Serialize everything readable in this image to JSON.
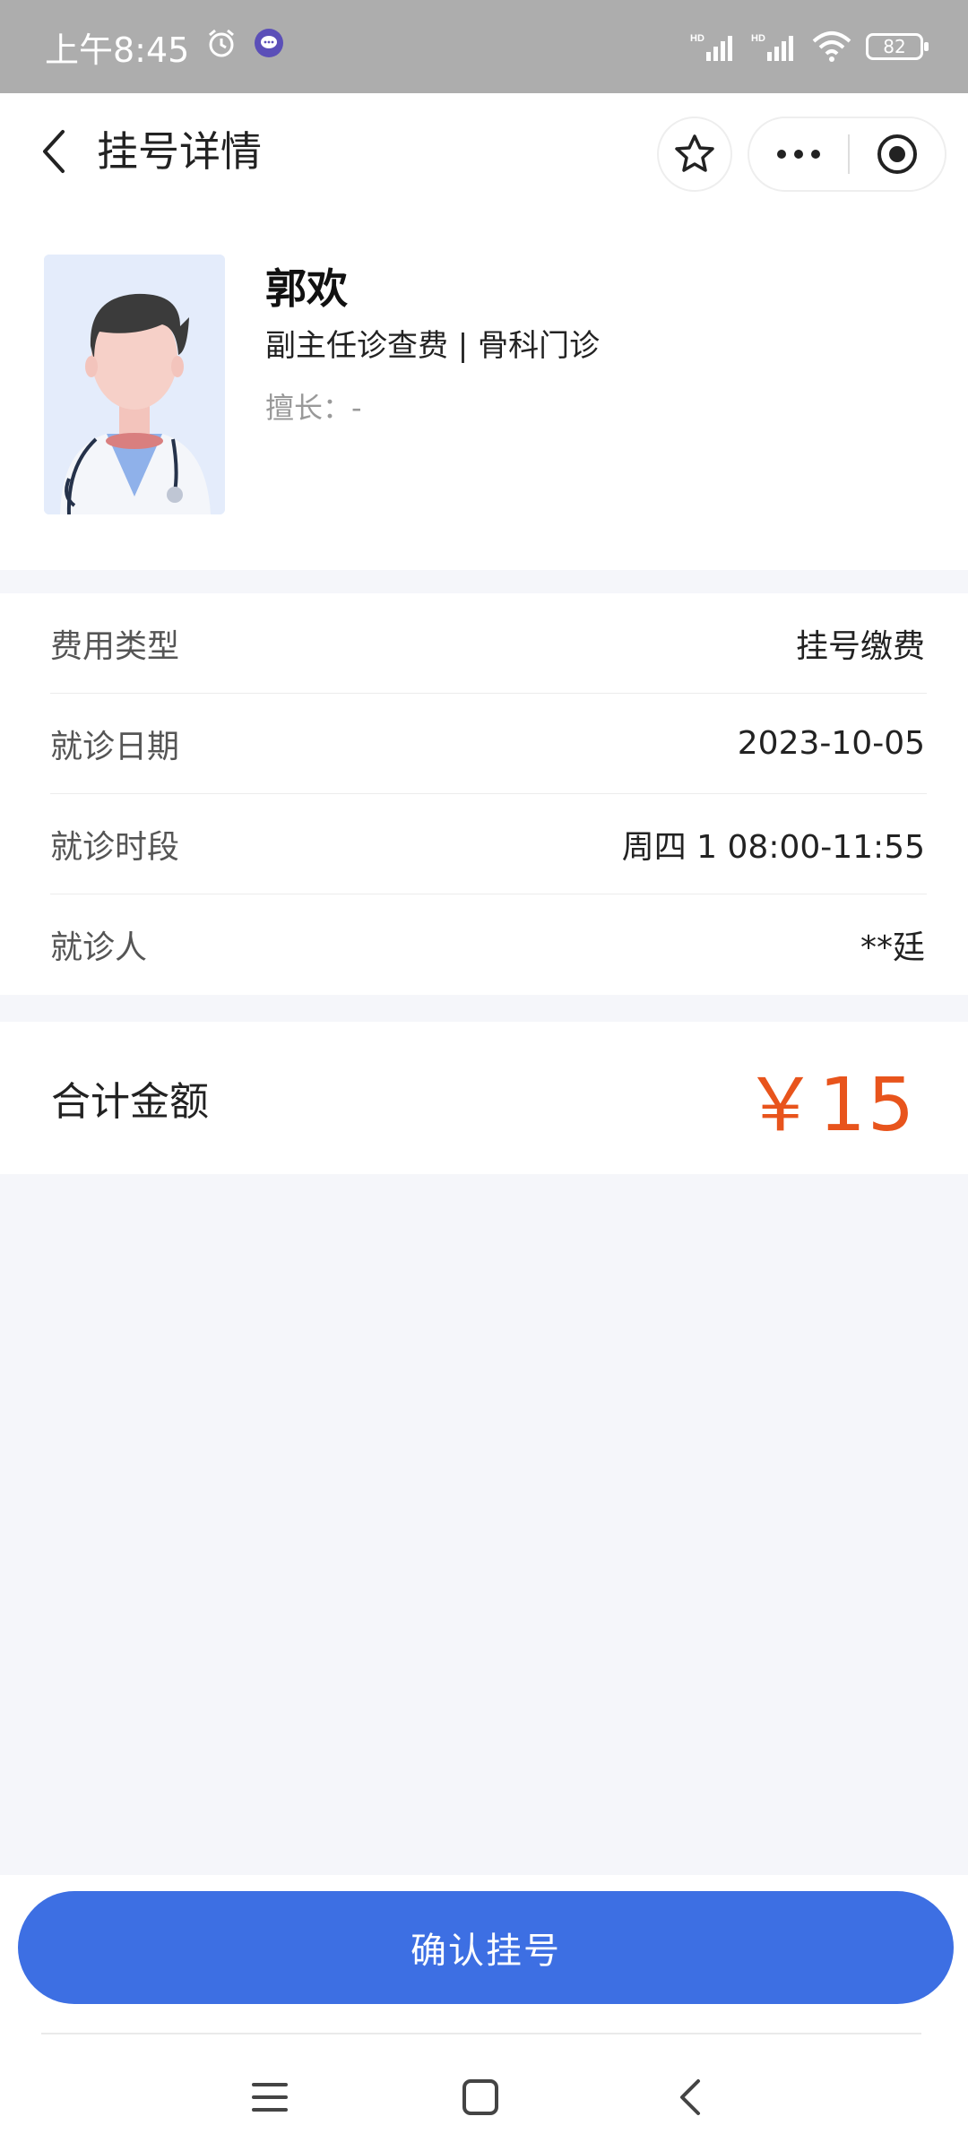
{
  "status_bar": {
    "time": "上午8:45",
    "network_1": "HD",
    "network_2": "HD",
    "battery": "82"
  },
  "nav": {
    "title": "挂号详情",
    "icons": [
      "back-icon",
      "star-icon",
      "more-icon",
      "target-icon"
    ]
  },
  "doctor": {
    "name": "郭欢",
    "title": "副主任诊查费 | 骨科门诊",
    "skill": "擅长：-"
  },
  "details": [
    {
      "label": "费用类型",
      "value": "挂号缴费"
    },
    {
      "label": "就诊日期",
      "value": "2023-10-05"
    },
    {
      "label": "就诊时段",
      "value": "周四 1 08:00-11:55"
    },
    {
      "label": "就诊人",
      "value": "**廷"
    }
  ],
  "total": {
    "label": "合计金额",
    "amount": "￥15"
  },
  "actions": {
    "confirm_label": "确认挂号"
  },
  "system_nav": {
    "icons": [
      "menu-icon",
      "home-icon",
      "back-icon"
    ]
  },
  "colors": {
    "accent": "#3d6fe3",
    "price": "#e8541c",
    "page_bg": "#f5f6fa",
    "status_bar": "#adadad"
  }
}
